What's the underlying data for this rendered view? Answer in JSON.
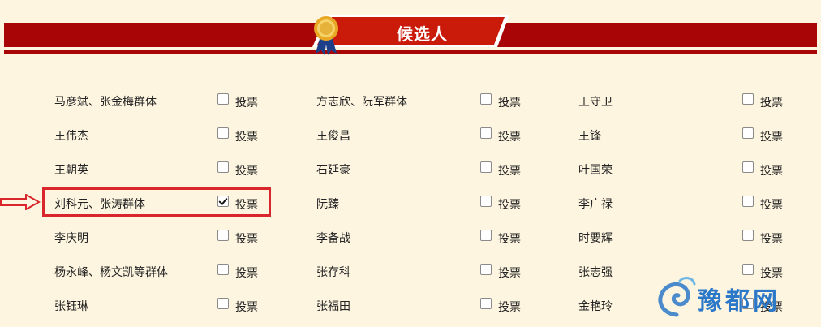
{
  "section_title": "候选人",
  "vote_label": "投票",
  "rows": [
    [
      {
        "name": "马彦斌、张金梅群体",
        "checked": false
      },
      {
        "name": "方志欣、阮军群体",
        "checked": false
      },
      {
        "name": "王守卫",
        "checked": false
      }
    ],
    [
      {
        "name": "王伟杰",
        "checked": false
      },
      {
        "name": "王俊昌",
        "checked": false
      },
      {
        "name": "王锋",
        "checked": false
      }
    ],
    [
      {
        "name": "王朝英",
        "checked": false
      },
      {
        "name": "石延豪",
        "checked": false
      },
      {
        "name": "叶国荣",
        "checked": false
      }
    ],
    [
      {
        "name": "刘科元、张涛群体",
        "checked": true
      },
      {
        "name": "阮臻",
        "checked": false
      },
      {
        "name": "李广禄",
        "checked": false
      }
    ],
    [
      {
        "name": "李庆明",
        "checked": false
      },
      {
        "name": "李备战",
        "checked": false
      },
      {
        "name": "时要辉",
        "checked": false
      }
    ],
    [
      {
        "name": "杨永峰、杨文凯等群体",
        "checked": false
      },
      {
        "name": "张存科",
        "checked": false
      },
      {
        "name": "张志强",
        "checked": false
      }
    ],
    [
      {
        "name": "张钰琳",
        "checked": false
      },
      {
        "name": "张福田",
        "checked": false
      },
      {
        "name": "金艳玲",
        "checked": false
      }
    ]
  ],
  "watermark": "豫都网",
  "colors": {
    "banner": "#a80606",
    "tab": "#c91a0a",
    "highlight": "#d9262c",
    "background": "#fdf5e0"
  }
}
